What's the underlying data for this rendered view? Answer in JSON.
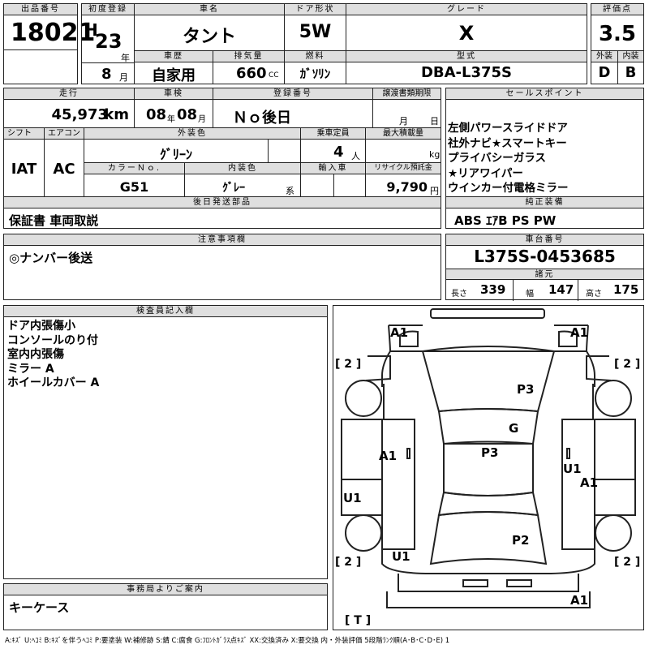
{
  "header": {
    "lot_no_label": "出品番号",
    "lot_no": "18021",
    "first_reg_label": "初度登録",
    "era": "H",
    "reg_year": "23",
    "year_unit": "年",
    "reg_month": "8",
    "month_unit": "月",
    "car_name_label": "車名",
    "car_name": "タント",
    "door_label": "ドア形状",
    "door": "5W",
    "grade_label": "グレード",
    "grade": "X",
    "score_label": "評価点",
    "score": "3.5",
    "history_label": "車歴",
    "history": "自家用",
    "displacement_label": "排気量",
    "displacement": "660",
    "displacement_unit": "CC",
    "fuel_label": "燃料",
    "fuel": "ｶﾞｿﾘﾝ",
    "model_label": "型式",
    "model": "DBA-L375S",
    "exterior_label": "外装",
    "exterior": "D",
    "interior_label": "内装",
    "interior": "B"
  },
  "row2": {
    "mileage_label": "走行",
    "mileage": "45,973",
    "mileage_unit": "km",
    "inspection_label": "車検",
    "insp_year": "08",
    "insp_year_unit": "年",
    "insp_month": "08",
    "insp_month_unit": "月",
    "plate_label": "登録番号",
    "plate": "Ｎｏ後日",
    "transfer_label": "譲渡書類期限",
    "transfer_month_unit": "月",
    "transfer_day_unit": "日"
  },
  "row3": {
    "shift_label": "シフト",
    "shift": "IAT",
    "ac_label": "エアコン",
    "ac": "AC",
    "color_label": "外装色",
    "color": "ｸﾞﾘｰﾝ",
    "capacity_label": "乗車定員",
    "capacity": "4",
    "capacity_unit": "人",
    "load_label": "最大積載量",
    "load_unit": "kg",
    "color_no_label": "カラーＮｏ.",
    "color_no": "G51",
    "int_color_label": "内装色",
    "int_color": "ｸﾞﾚｰ",
    "int_color_unit": "系",
    "import_label": "輸入車",
    "recycle_label": "リサイクル預託金",
    "recycle": "9,790",
    "recycle_unit": "円"
  },
  "later": {
    "label": "後日発送部品",
    "value": "保証書 車両取説"
  },
  "sales": {
    "label": "セールスポイント",
    "lines": "左側パワースライドドア\n社外ナビ★スマートキー\nプライバシーガラス\n★リアワイパー\nウインカー付電格ミラー"
  },
  "standard": {
    "label": "純正装備",
    "value": "ABS ｴｱB PS PW"
  },
  "notes": {
    "label": "注意事項欄",
    "value": "◎ナンバー後送"
  },
  "chassis": {
    "label": "車台番号",
    "value": "L375S-0453685",
    "dims_label": "諸元",
    "length_label": "長さ",
    "length": "339",
    "width_label": "幅",
    "width": "147",
    "height_label": "高さ",
    "height": "175"
  },
  "inspector": {
    "label": "検査員記入欄",
    "lines": "ドア内張傷小\nコンソールのり付\n室内内張傷\nミラー A\nホイールカバー A"
  },
  "diagram": {
    "a1_fl": "A1",
    "a1_fr": "A1",
    "tire_fl": "[ 2 ]",
    "tire_fr": "[ 2 ]",
    "tire_rl": "[ 2 ]",
    "tire_rr": "[ 2 ]",
    "hood": "P3",
    "glass": "G",
    "roof": "P3",
    "door_left": "A1",
    "u1_right": "U1",
    "a1_right": "A1",
    "u1_left": "U1",
    "trunk": "P2",
    "u1_rear": "U1",
    "a1_rear": "A1",
    "spare": "[ T ]"
  },
  "office": {
    "label": "事務局よりご案内",
    "value": "キーケース"
  },
  "legend": "A:ｷｽﾞ U:ﾍｺﾐ B:ｷｽﾞを伴うﾍｺﾐ P:要塗装 W:補修跡 S:錆 C:腐食 G:ﾌﾛﾝﾄｶﾞﾗｽ点ｷｽﾞ XX:交換済み X:要交換  内・外装評価  5段階ﾗﾝｸ順(A･B･C･D･E) 1"
}
